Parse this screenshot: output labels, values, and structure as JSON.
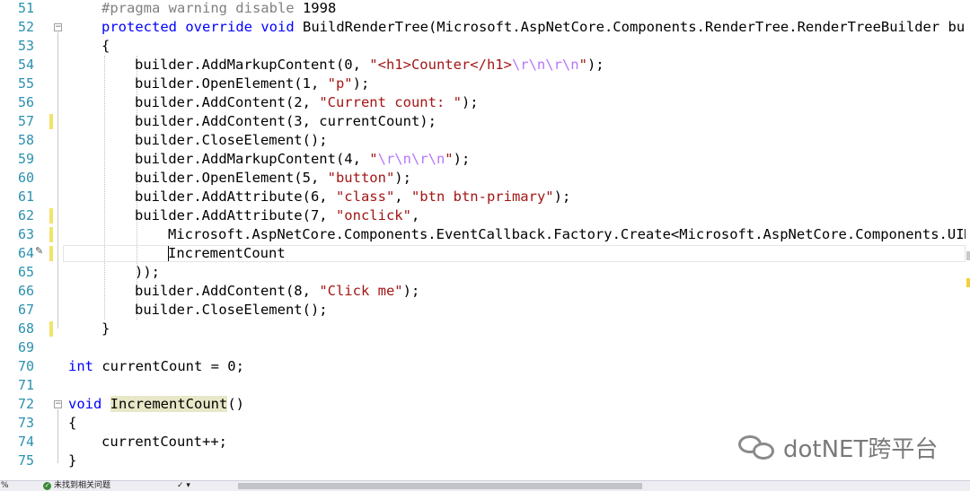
{
  "gutter": {
    "line_numbers": [
      "51",
      "52",
      "53",
      "54",
      "55",
      "56",
      "57",
      "58",
      "59",
      "60",
      "61",
      "62",
      "63",
      "64",
      "65",
      "66",
      "67",
      "68",
      "69",
      "70",
      "71",
      "72",
      "73",
      "74",
      "75"
    ]
  },
  "code": {
    "l51": {
      "pp": "#pragma warning disable",
      "num": " 1998"
    },
    "l52": {
      "kw1": "protected",
      "kw2": "override",
      "kw3": "void",
      "rest": " BuildRenderTree(Microsoft.AspNetCore.Components.RenderTree.RenderTreeBuilder bu"
    },
    "l53": {
      "text": "{"
    },
    "l54": {
      "a": "builder.AddMarkupContent(0, ",
      "s1": "\"<h1>Counter</h1>",
      "e1": "\\r\\n\\r\\n",
      "s2": "\"",
      "b": ");"
    },
    "l55": {
      "a": "builder.OpenElement(1, ",
      "s": "\"p\"",
      "b": ");"
    },
    "l56": {
      "a": "builder.AddContent(2, ",
      "s": "\"Current count: \"",
      "b": ");"
    },
    "l57": {
      "text": "builder.AddContent(3, currentCount);"
    },
    "l58": {
      "text": "builder.CloseElement();"
    },
    "l59": {
      "a": "builder.AddMarkupContent(4, ",
      "s1": "\"",
      "e1": "\\r\\n\\r\\n",
      "s2": "\"",
      "b": ");"
    },
    "l60": {
      "a": "builder.OpenElement(5, ",
      "s": "\"button\"",
      "b": ");"
    },
    "l61": {
      "a": "builder.AddAttribute(6, ",
      "s1": "\"class\"",
      "m": ", ",
      "s2": "\"btn btn-primary\"",
      "b": ");"
    },
    "l62": {
      "a": "builder.AddAttribute(7, ",
      "s": "\"onclick\"",
      "b": ","
    },
    "l63": {
      "text": "Microsoft.AspNetCore.Components.EventCallback.Factory.Create<Microsoft.AspNetCore.Components.UIM"
    },
    "l64": {
      "text": "IncrementCount"
    },
    "l65": {
      "text": "));"
    },
    "l66": {
      "a": "builder.AddContent(8, ",
      "s": "\"Click me\"",
      "b": ");"
    },
    "l67": {
      "text": "builder.CloseElement();"
    },
    "l68": {
      "text": "}"
    },
    "l69": {
      "text": ""
    },
    "l70": {
      "kw": "int",
      "rest": " currentCount = 0;"
    },
    "l71": {
      "text": ""
    },
    "l72": {
      "kw": "void",
      "sp": " ",
      "hl": "IncrementCount",
      "rest": "()"
    },
    "l73": {
      "text": "{"
    },
    "l74": {
      "text": "currentCount++;"
    },
    "l75": {
      "text": "}"
    }
  },
  "statusbar": {
    "zoom_pct": "%",
    "status_text": "未找到相关问题",
    "tool_label": "✓ ▾"
  },
  "watermark": {
    "text": "dotNET跨平台"
  },
  "colors": {
    "keyword": "#0000ff",
    "string": "#a31515",
    "escape": "#b776fb",
    "line_number": "#2b91af",
    "preprocessor": "#808080",
    "change_bar": "#f3e36b"
  }
}
